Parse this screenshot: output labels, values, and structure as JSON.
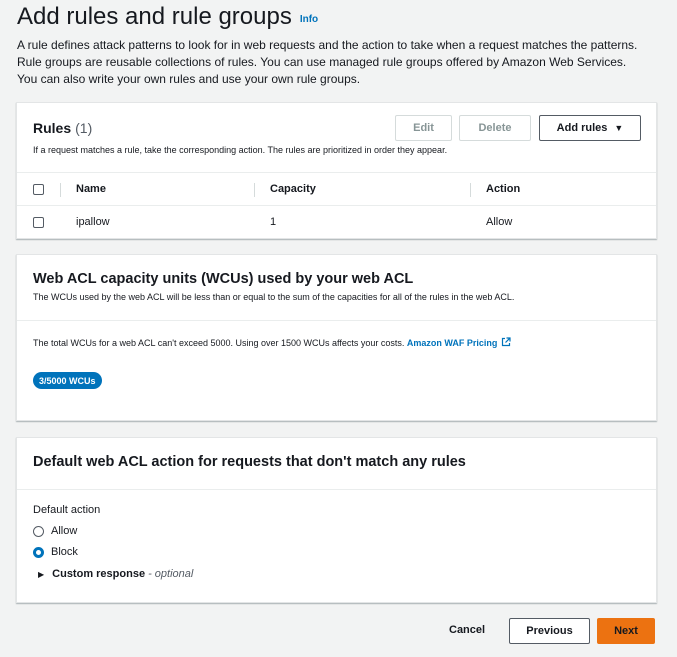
{
  "header": {
    "title": "Add rules and rule groups",
    "info": "Info",
    "description": "A rule defines attack patterns to look for in web requests and the action to take when a request matches the patterns. Rule groups are reusable collections of rules. You can use managed rule groups offered by Amazon Web Services. You can also write your own rules and use your own rule groups."
  },
  "rules": {
    "title": "Rules",
    "count": "(1)",
    "description": "If a request matches a rule, take the corresponding action. The rules are prioritized in order they appear.",
    "edit_label": "Edit",
    "delete_label": "Delete",
    "add_label": "Add rules",
    "columns": [
      "Name",
      "Capacity",
      "Action"
    ],
    "rows": [
      {
        "name": "ipallow",
        "capacity": "1",
        "action": "Allow"
      }
    ]
  },
  "wcu": {
    "title": "Web ACL capacity units (WCUs) used by your web ACL",
    "description": "The WCUs used by the web ACL will be less than or equal to the sum of the capacities for all of the rules in the web ACL.",
    "note": "The total WCUs for a web ACL can't exceed 5000. Using over 1500 WCUs affects your costs.",
    "pricing_link": "Amazon WAF Pricing",
    "badge": "3/5000 WCUs"
  },
  "default_action": {
    "title": "Default web ACL action for requests that don't match any rules",
    "label": "Default action",
    "options": [
      "Allow",
      "Block"
    ],
    "selected": "Block",
    "custom_response": "Custom response",
    "optional": "- optional"
  },
  "footer": {
    "cancel": "Cancel",
    "previous": "Previous",
    "next": "Next"
  },
  "colors": {
    "accent": "#0073bb",
    "primary_button": "#ec7211",
    "background": "#f2f3f3"
  }
}
